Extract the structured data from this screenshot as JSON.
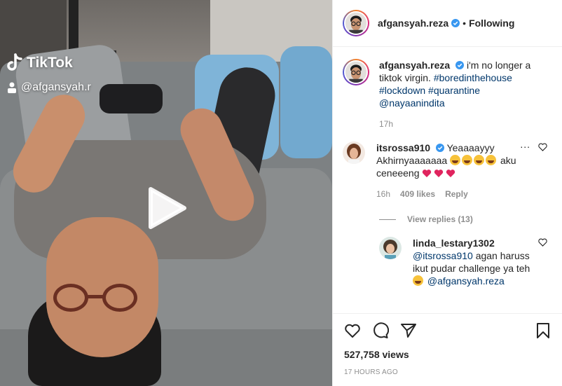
{
  "media": {
    "tiktok_logo_text": "TikTok",
    "tiktok_username": "@afgansyah.r"
  },
  "header": {
    "username": "afgansyah.reza",
    "separator": "•",
    "following_label": "Following"
  },
  "caption": {
    "username": "afgansyah.reza",
    "text": "i'm no longer a tiktok virgin.",
    "hashtags": [
      "#boredinthehouse",
      "#lockdown",
      "#quarantine"
    ],
    "mention": "@nayaanindita",
    "time": "17h"
  },
  "comments": [
    {
      "username": "itsrossa910",
      "text_prefix": "Yeaaaayyy Akhirnyaaaaaaa",
      "text_mid": "aku ceneeeng",
      "time": "16h",
      "likes": "409 likes",
      "reply_label": "Reply",
      "more": "..."
    }
  ],
  "view_replies": "View replies (13)",
  "reply": {
    "username": "linda_lestary1302",
    "mention1": "@itsrossa910",
    "text": "agan haruss ikut pudar challenge ya teh",
    "mention2": "@afgansyah.reza"
  },
  "stats": {
    "views": "527,758 views",
    "age": "17 HOURS AGO"
  },
  "colors": {
    "verified": "#3897f0",
    "link": "#00376b",
    "muted": "#8e8e8e",
    "heart_red": "#ed4956"
  },
  "icons": [
    "heart-icon",
    "comment-icon",
    "share-icon",
    "bookmark-icon",
    "play-icon",
    "verified-icon"
  ]
}
